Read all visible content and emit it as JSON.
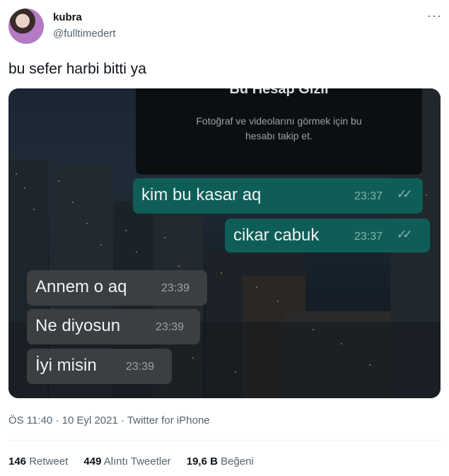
{
  "author": {
    "name": "kubra",
    "handle": "@fulltimedert"
  },
  "tweet": {
    "text": "bu sefer harbi bitti ya"
  },
  "media": {
    "card": {
      "title": "Bu Hesap Gizli",
      "desc_line1": "Fotoğraf ve videolarını görmek için bu",
      "desc_line2": "hesabı takip et."
    },
    "messages": [
      {
        "text": "kim bu kasar aq",
        "time": "23:37",
        "side": "sent"
      },
      {
        "text": "cikar cabuk",
        "time": "23:37",
        "side": "sent"
      },
      {
        "text": "Annem o aq",
        "time": "23:39",
        "side": "received"
      },
      {
        "text": "Ne diyosun",
        "time": "23:39",
        "side": "received"
      },
      {
        "text": "İyi misin",
        "time": "23:39",
        "side": "received"
      }
    ]
  },
  "meta": {
    "time": "ÖS 11:40",
    "date": "10 Eyl 2021",
    "source": "Twitter for iPhone",
    "sep": "·"
  },
  "stats": {
    "retweets": {
      "count": "146",
      "label": "Retweet"
    },
    "quotes": {
      "count": "449",
      "label": "Alıntı Tweetler"
    },
    "likes": {
      "count": "19,6 B",
      "label": "Beğeni"
    }
  },
  "icons": {
    "more": "more-dots-icon",
    "read_receipt": "double-check-icon"
  }
}
